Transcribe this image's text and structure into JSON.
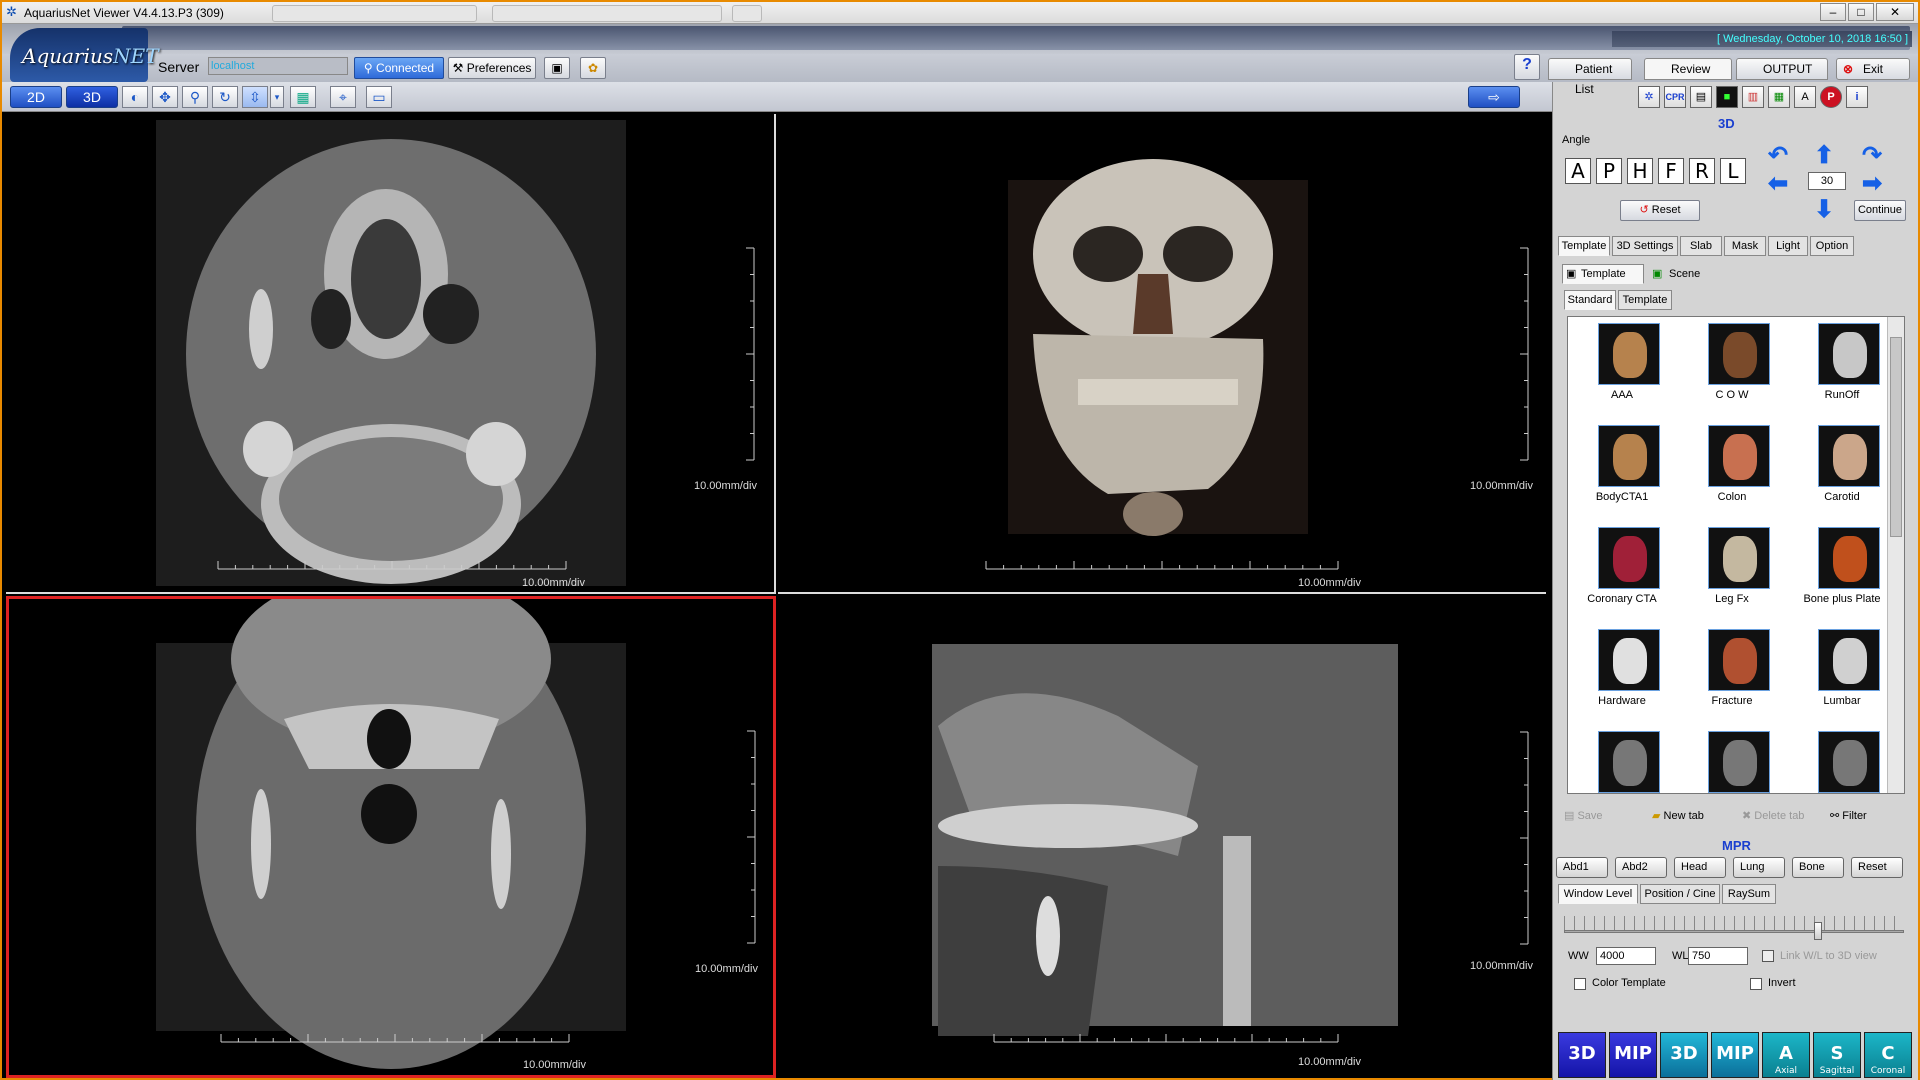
{
  "window": {
    "title": "AquariusNet Viewer   V4.4.13.P3 (309)",
    "date": "[ Wednesday, October 10, 2018  16:50 ]"
  },
  "logo": {
    "part1": "Aquarius",
    "part2": "NET"
  },
  "toolbar": {
    "server_label": "Server",
    "server_value": "localhost",
    "connected": "Connected",
    "preferences": "Preferences"
  },
  "viewbar": {
    "mode_2d": "2D",
    "mode_3d": "3D"
  },
  "right_tabs": {
    "patient_list": "Patient List",
    "review": "Review",
    "output": "OUTPUT",
    "exit": "Exit"
  },
  "right_tools": [
    "CPR"
  ],
  "panel": {
    "section_3d": "3D",
    "angle_label": "Angle",
    "angle_buttons": [
      "A",
      "P",
      "H",
      "F",
      "R",
      "L"
    ],
    "angle_value": "30",
    "reset": "Reset",
    "continue": "Continue",
    "tabs": [
      "Template",
      "3D Settings",
      "Slab",
      "Mask",
      "Light",
      "Option"
    ],
    "subtabs": {
      "template": "Template",
      "scene": "Scene"
    },
    "lib_tabs": [
      "Standard",
      "Template"
    ],
    "templates": [
      "AAA",
      "C O W",
      "RunOff",
      "BodyCTA1",
      "Colon",
      "Carotid",
      "Coronary CTA",
      "Leg Fx",
      "Bone plus Plate",
      "Hardware",
      "Fracture",
      "Lumbar",
      "",
      "",
      ""
    ],
    "actions": {
      "save": "Save",
      "new_tab": "New tab",
      "delete_tab": "Delete tab",
      "filter": "Filter"
    },
    "section_mpr": "MPR",
    "presets": [
      "Abd1",
      "Abd2",
      "Head",
      "Lung",
      "Bone",
      "Reset"
    ],
    "wl_tabs": [
      "Window Level",
      "Position / Cine",
      "RaySum"
    ],
    "ww_label": "WW",
    "ww_value": "4000",
    "wl_label": "WL",
    "wl_value": "750",
    "link_label": "Link W/L to 3D view",
    "color_template": "Color Template",
    "invert": "Invert",
    "bottom_buttons": [
      {
        "text": "3D",
        "sub": ""
      },
      {
        "text": "MIP",
        "sub": ""
      },
      {
        "text": "3D",
        "sub": ""
      },
      {
        "text": "MIP",
        "sub": ""
      },
      {
        "text": "A",
        "sub": "Axial"
      },
      {
        "text": "S",
        "sub": "Sagittal"
      },
      {
        "text": "C",
        "sub": "Coronal"
      }
    ]
  },
  "viewports": {
    "scale": "10.00mm/div"
  },
  "colors": {
    "accent": "#2e6ad9",
    "active_border": "#d22",
    "frame": "#e88a00"
  }
}
